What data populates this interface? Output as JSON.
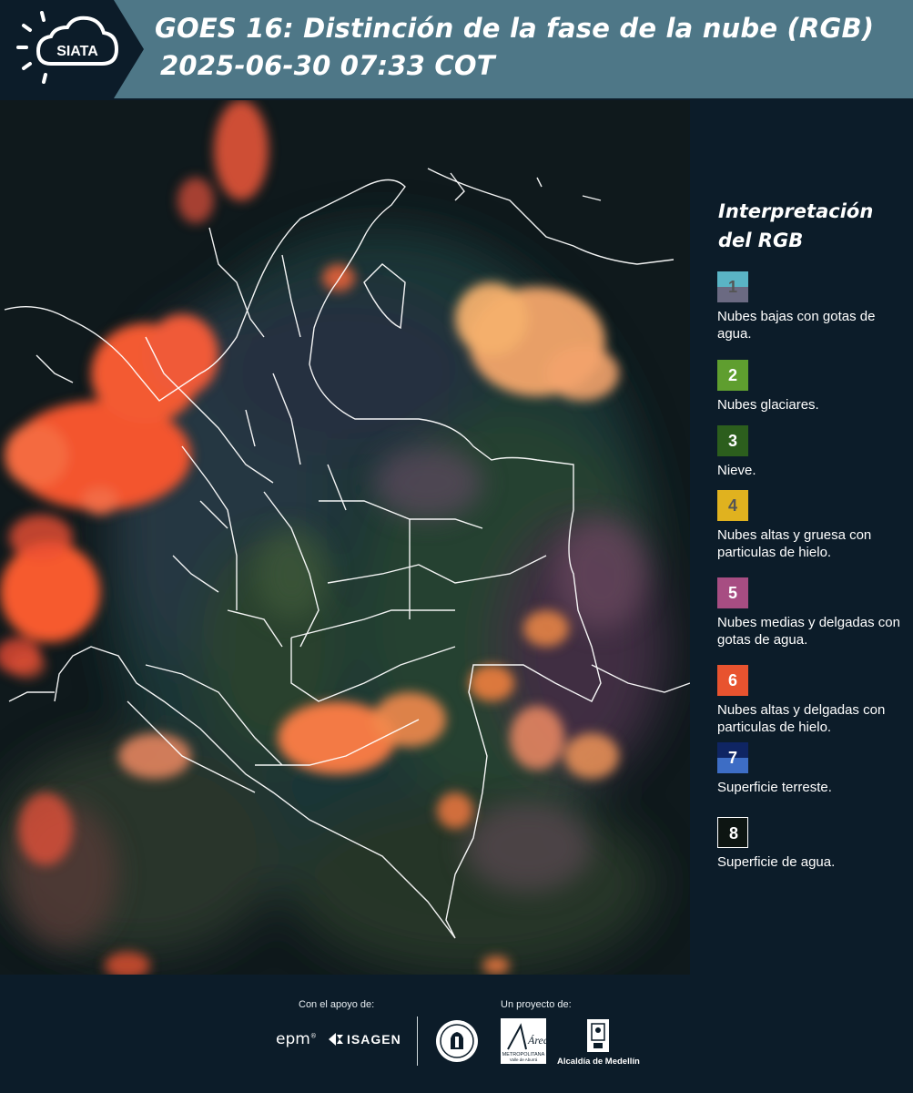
{
  "header": {
    "logo_text": "SIATA",
    "title": "GOES 16: Distinción de la fase de la nube (RGB)",
    "datetime": "2025-06-30 07:33 COT"
  },
  "legend": {
    "title_line1": "Interpretación",
    "title_line2": "del RGB",
    "items": [
      {
        "number": "1",
        "label": "Nubes bajas con gotas de agua.",
        "color_top": "#5ab4c5",
        "color_bottom": "#6b6a82",
        "text_color": "#555555"
      },
      {
        "number": "2",
        "label": "Nubes glaciares.",
        "color_top": "#5f9e2f",
        "color_bottom": "#5f9e2f",
        "text_color": "#ffffff"
      },
      {
        "number": "3",
        "label": "Nieve.",
        "color_top": "#2c5e1d",
        "color_bottom": "#2c5e1d",
        "text_color": "#ffffff"
      },
      {
        "number": "4",
        "label": "Nubes altas y gruesa con particulas de hielo.",
        "color_top": "#e0b21f",
        "color_bottom": "#e0b21f",
        "text_color": "#555555"
      },
      {
        "number": "5",
        "label": "Nubes medias y delgadas con gotas de agua.",
        "color_top": "#a74d82",
        "color_bottom": "#a74d82",
        "text_color": "#ffffff"
      },
      {
        "number": "6",
        "label": "Nubes altas y delgadas con particulas de hielo.",
        "color_top": "#e8532f",
        "color_bottom": "#e8532f",
        "text_color": "#ffffff"
      },
      {
        "number": "7",
        "label": "Superficie terreste.",
        "color_top": "#0f2563",
        "color_bottom": "#3d6dc5",
        "text_color": "#ffffff"
      },
      {
        "number": "8",
        "label": "Superficie de agua.",
        "color_top": "#0d1512",
        "color_bottom": "#0d1512",
        "text_color": "#ffffff"
      }
    ]
  },
  "footer": {
    "support_label": "Con el apoyo de:",
    "project_label": "Un proyecto de:",
    "sponsor_epm": "epm",
    "sponsor_isagen": "ISAGEN",
    "area_metropolitana": "Área",
    "area_sub": "METROPOLITANA",
    "area_sub2": "Valle de Aburrá",
    "alcaldia": "Alcaldía de Medellín"
  },
  "colors": {
    "header_band": "#4e7787",
    "background": "#0c1c29"
  }
}
